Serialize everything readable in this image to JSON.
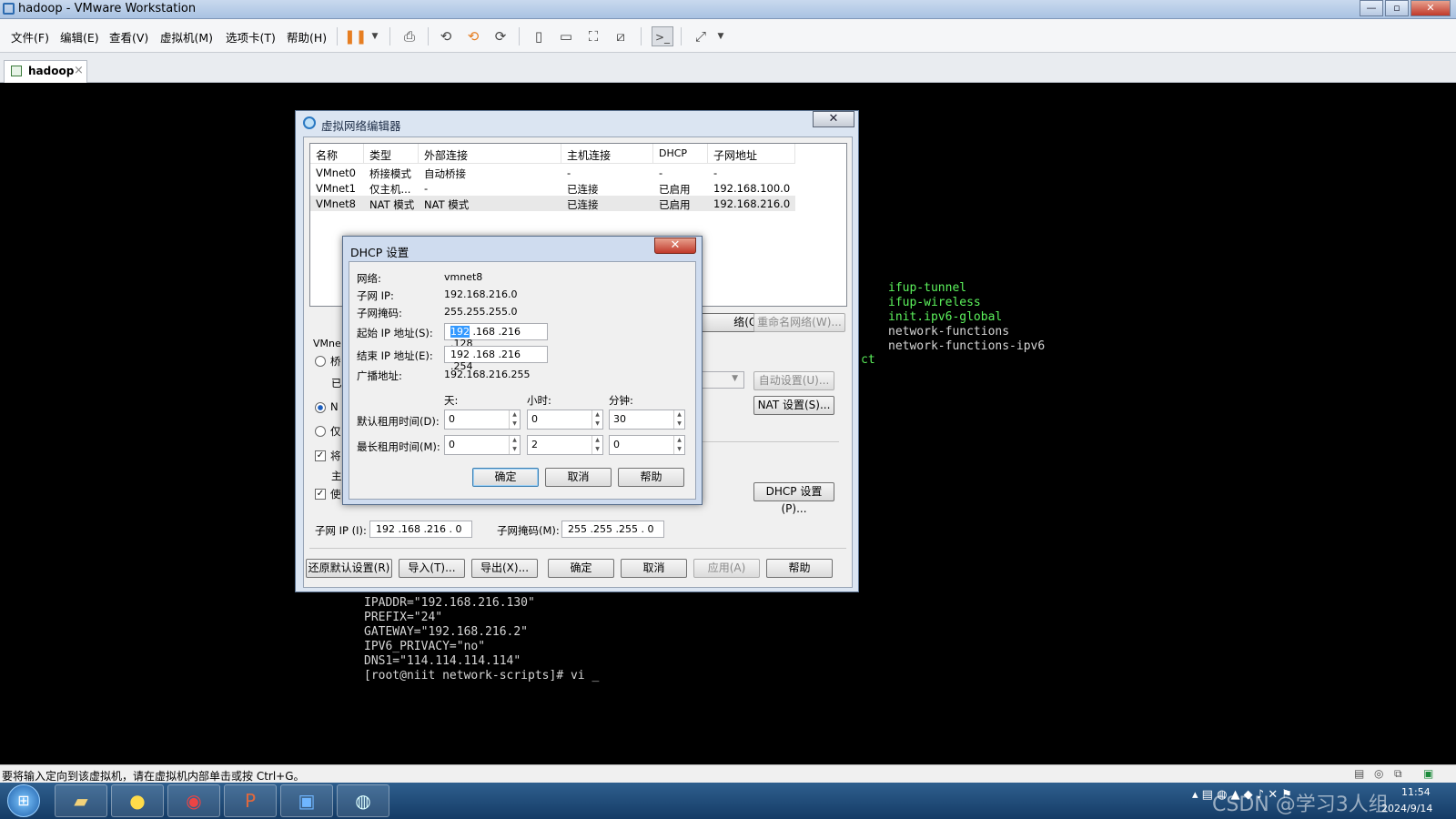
{
  "window": {
    "title": "hadoop - VMware Workstation",
    "min": "—",
    "max": "▫",
    "close": "✕"
  },
  "menu": [
    "文件(F)",
    "编辑(E)",
    "查看(V)",
    "虚拟机(M)",
    "选项卡(T)",
    "帮助(H)"
  ],
  "tab": {
    "label": "hadoop",
    "close": "×"
  },
  "console": {
    "right_lines": [
      {
        "text": "ifup-tunnel",
        "color": "green"
      },
      {
        "text": "ifup-wireless",
        "color": "green"
      },
      {
        "text": "init.ipv6-global",
        "color": "green"
      },
      {
        "text": "network-functions",
        "color": "white"
      },
      {
        "text": "network-functions-ipv6",
        "color": "white"
      }
    ],
    "fragment": "ct",
    "bottom_lines": [
      "IPADDR=\"192.168.216.130\"",
      "PREFIX=\"24\"",
      "GATEWAY=\"192.168.216.2\"",
      "IPV6_PRIVACY=\"no\"",
      "DNS1=\"114.114.114.114\"",
      "[root@niit network-scripts]# vi _"
    ]
  },
  "vne": {
    "title": "虚拟网络编辑器",
    "close": "✕",
    "columns": [
      "名称",
      "类型",
      "外部连接",
      "主机连接",
      "DHCP",
      "子网地址"
    ],
    "rows": [
      [
        "VMnet0",
        "桥接模式",
        "自动桥接",
        "-",
        "-",
        "-"
      ],
      [
        "VMnet1",
        "仅主机...",
        "-",
        "已连接",
        "已启用",
        "192.168.100.0"
      ],
      [
        "VMnet8",
        "NAT 模式",
        "NAT 模式",
        "已连接",
        "已启用",
        "192.168.216.0"
      ]
    ],
    "add_net_partial": "络(O)",
    "rename_net": "重命名网络(W)...",
    "vmnet_info_partial": "VMne",
    "radio_bridge": "桥",
    "radio_bridge_sub": "已",
    "radio_nat": "N",
    "radio_host": "仅",
    "check_connect": "将",
    "check_connect_sub": "主",
    "check_dhcp": "使",
    "auto_setting": "自动设置(U)...",
    "nat_setting": "NAT 设置(S)...",
    "dhcp_setting": "DHCP 设置(P)...",
    "subnet_ip_label": "子网 IP (I):",
    "subnet_ip": "192 .168 .216 . 0",
    "subnet_mask_label": "子网掩码(M):",
    "subnet_mask": "255 .255 .255 . 0",
    "buttons": [
      "还原默认设置(R)",
      "导入(T)...",
      "导出(X)...",
      "确定",
      "取消",
      "应用(A)",
      "帮助"
    ]
  },
  "dhcp": {
    "title": "DHCP 设置",
    "close": "✕",
    "network_label": "网络:",
    "network": "vmnet8",
    "subnet_label": "子网 IP:",
    "subnet": "192.168.216.0",
    "mask_label": "子网掩码:",
    "mask": "255.255.255.0",
    "start_label": "起始 IP 地址(S):",
    "start_sel": "192",
    "start_rest": " .168 .216 .128",
    "end_label": "结束 IP 地址(E):",
    "end": "192 .168 .216 .254",
    "bcast_label": "广播地址:",
    "bcast": "192.168.216.255",
    "col_day": "天:",
    "col_hour": "小时:",
    "col_min": "分钟:",
    "default_lease_label": "默认租用时间(D):",
    "default_lease": [
      "0",
      "0",
      "30"
    ],
    "max_lease_label": "最长租用时间(M):",
    "max_lease": [
      "0",
      "2",
      "0"
    ],
    "ok": "确定",
    "cancel": "取消",
    "help": "帮助"
  },
  "status": {
    "text": "要将输入定向到该虚拟机，请在虚拟机内部单击或按 Ctrl+G。"
  },
  "tray": {
    "time": "11:54",
    "date": "2024/9/14",
    "watermark": "CSDN @学习3人组"
  },
  "icons": {
    "start": "windows-orb",
    "explorer": "folder-icon",
    "qq": "qq-icon",
    "chrome": "chrome-icon",
    "ppt": "powerpoint-icon",
    "vmware": "vmware-icon",
    "network": "globe-icon"
  }
}
